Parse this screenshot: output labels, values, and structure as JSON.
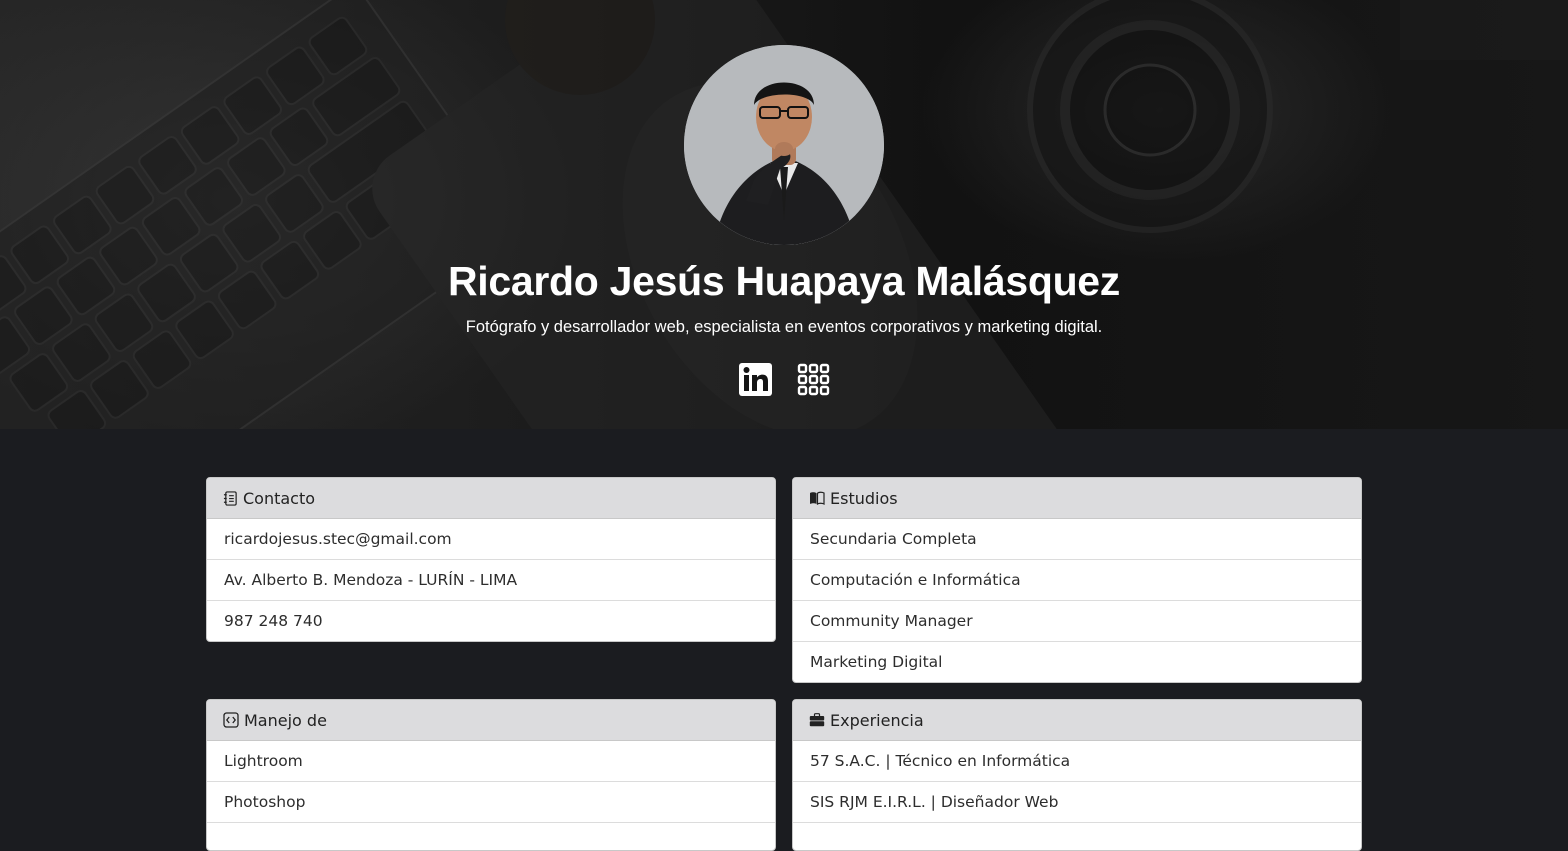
{
  "profile": {
    "name": "Ricardo Jesús Huapaya Malásquez",
    "tagline": "Fotógrafo y desarrollador web, especialista en eventos corporativos y marketing digital.",
    "avatar_icon": "portrait-photo"
  },
  "social": [
    {
      "icon": "linkedin-icon"
    },
    {
      "icon": "apps-grid-icon"
    }
  ],
  "cards": {
    "contacto": {
      "icon": "contact-list-icon",
      "title": "Contacto",
      "items": [
        "ricardojesus.stec@gmail.com",
        "Av. Alberto B. Mendoza - LURÍN - LIMA",
        "987 248 740"
      ]
    },
    "estudios": {
      "icon": "book-icon",
      "title": "Estudios",
      "items": [
        "Secundaria Completa",
        "Computación e Informática",
        "Community Manager",
        "Marketing Digital"
      ]
    },
    "manejo": {
      "icon": "code-icon",
      "title": "Manejo de",
      "items": [
        "Lightroom",
        "Photoshop"
      ]
    },
    "experiencia": {
      "icon": "briefcase-icon",
      "title": "Experiencia",
      "items": [
        "57 S.A.C. | Técnico en Informática",
        "SIS RJM E.I.R.L. | Diseñador Web"
      ]
    }
  },
  "colors": {
    "page_bg": "#1b1c20",
    "card_header_bg": "#dcdcde",
    "text": "#2d2d2d"
  }
}
